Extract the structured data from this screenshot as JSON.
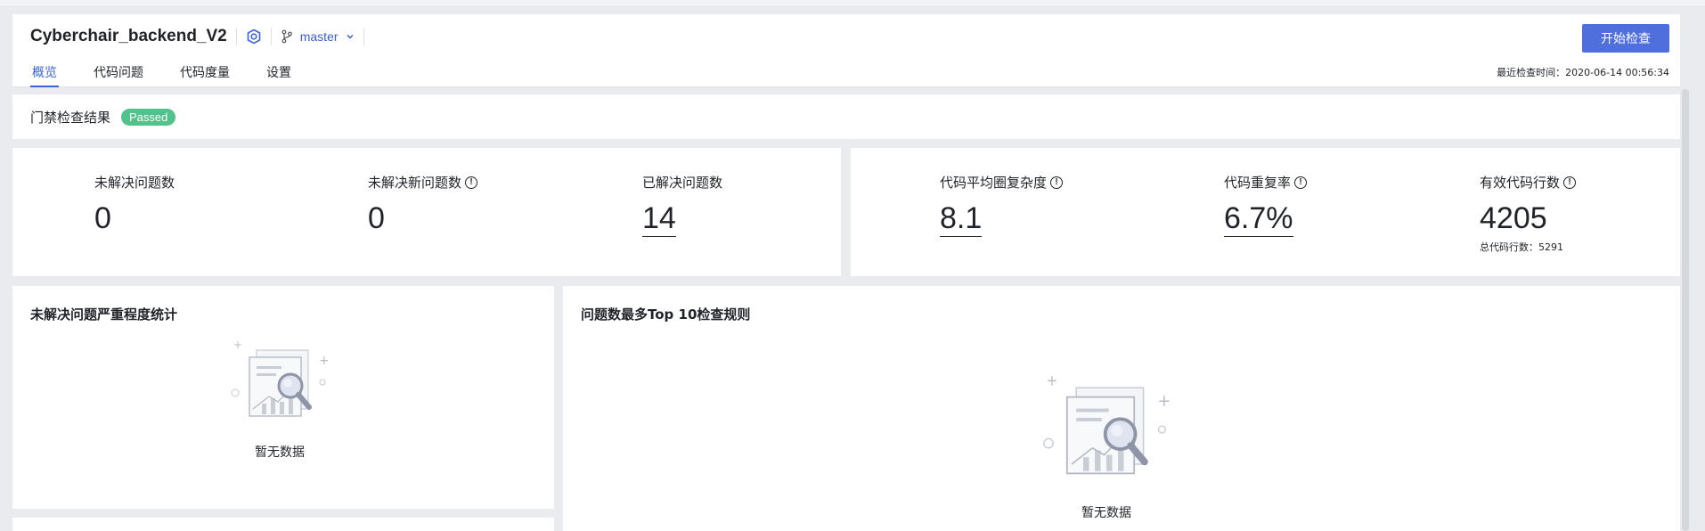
{
  "header": {
    "repo_name": "Cyberchair_backend_V2",
    "branch": "master",
    "start_button": "开始检查",
    "last_check": "最近检查时间：2020-06-14 00:56:34",
    "tabs": [
      {
        "label": "概览",
        "active": true
      },
      {
        "label": "代码问题",
        "active": false
      },
      {
        "label": "代码度量",
        "active": false
      },
      {
        "label": "设置",
        "active": false
      }
    ],
    "icons": [
      "settings-shield-icon",
      "branch-icon",
      "chevron-down-icon"
    ]
  },
  "gate": {
    "title": "门禁检查结果",
    "status": "Passed",
    "status_color": "#52c28b"
  },
  "metrics": {
    "unresolved": {
      "label": "未解决问题数",
      "value": "0"
    },
    "unresolved_new": {
      "label": "未解决新问题数",
      "value": "0"
    },
    "resolved": {
      "label": "已解决问题数",
      "value": "14"
    },
    "complexity": {
      "label": "代码平均圈复杂度",
      "value": "8.1"
    },
    "duplication": {
      "label": "代码重复率",
      "value": "6.7%"
    },
    "effective_lines": {
      "label": "有效代码行数",
      "value": "4205",
      "sub": "总代码行数：5291"
    }
  },
  "panels": {
    "severity": {
      "title": "未解决问题严重程度统计",
      "empty": "暂无数据"
    },
    "top10": {
      "title": "问题数最多Top 10检查规则",
      "empty": "暂无数据"
    }
  },
  "colors": {
    "accent": "#4f6fdc",
    "tab_active": "#3a63d6"
  }
}
